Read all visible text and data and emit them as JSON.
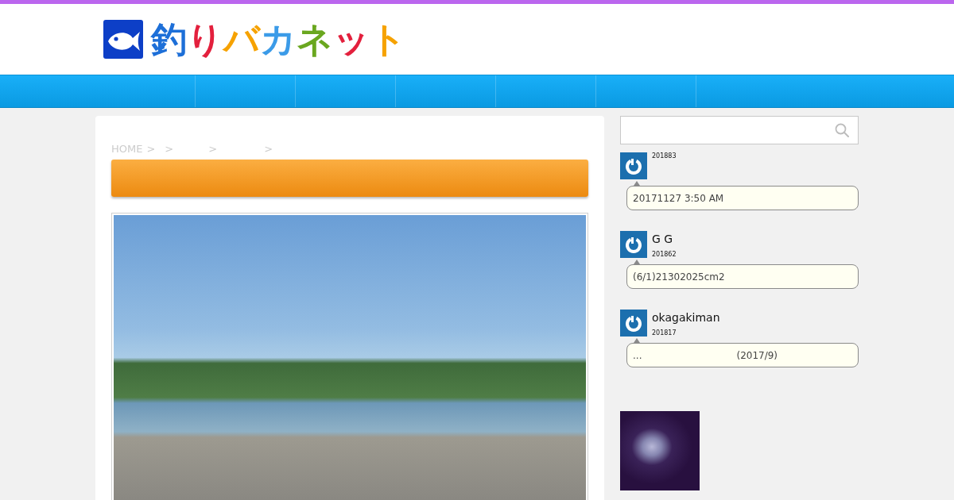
{
  "header": {
    "logo_text": "釣りバカネット"
  },
  "breadcrumb": [
    "HOME",
    ">",
    ">",
    ">",
    ">"
  ],
  "sidebar": {
    "comments": [
      {
        "date": "201883",
        "text": [
          "20171127 3:50 AM"
        ]
      },
      {
        "author": "G G",
        "date": "201862",
        "text": [
          "(6/1)21302025cm2"
        ]
      },
      {
        "author": "okagakiman",
        "date": "201817",
        "text": [
          "...",
          "(2017/9)"
        ]
      }
    ]
  }
}
